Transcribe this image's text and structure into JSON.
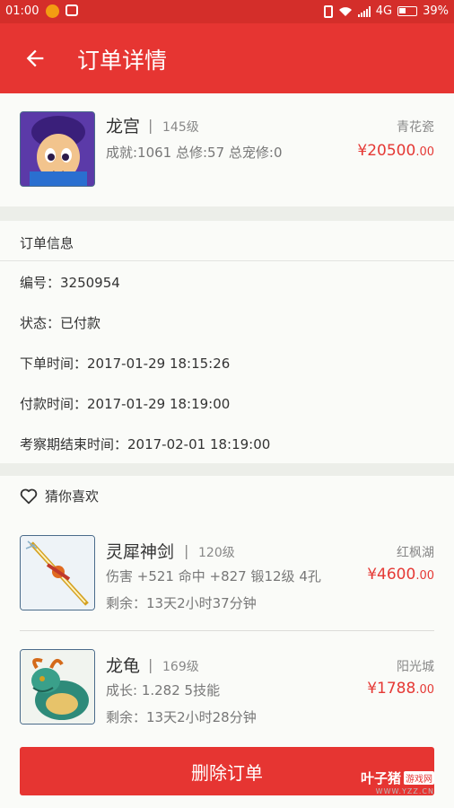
{
  "status_bar": {
    "time": "01:00",
    "network": "4G",
    "battery": "39%"
  },
  "app_bar": {
    "title": "订单详情"
  },
  "order_item": {
    "name": "龙宫",
    "separator": "|",
    "level": "145级",
    "server": "青花瓷",
    "stats": "成就:1061  总修:57  总宠修:0",
    "price_int": "¥20500",
    "price_dec": ".00",
    "thumbnail_icon": "character-portrait-icon"
  },
  "order_info": {
    "title": "订单信息",
    "number": "编号：3250954",
    "status": "状态：已付款",
    "order_time": "下单时间：2017-01-29 18:15:26",
    "pay_time": "付款时间：2017-01-29 18:19:00",
    "review_end": "考察期结束时间：2017-02-01 18:19:00"
  },
  "recommend": {
    "title": "猜你喜欢",
    "items": [
      {
        "name": "灵犀神剑",
        "separator": "|",
        "level": "120级",
        "server": "红枫湖",
        "stats": "伤害 +521  命中 +827  锻12级  4孔",
        "remaining": "剩余：13天2小时37分钟",
        "price_int": "¥4600",
        "price_dec": ".00",
        "thumbnail_icon": "sword-icon"
      },
      {
        "name": "龙龟",
        "separator": "|",
        "level": "169级",
        "server": "阳光城",
        "stats": "成长: 1.282  5技能",
        "remaining": "剩余：13天2小时28分钟",
        "price_int": "¥1788",
        "price_dec": ".00",
        "thumbnail_icon": "dragon-icon"
      }
    ]
  },
  "actions": {
    "delete_label": "删除订单"
  },
  "watermark": {
    "brand": "叶子猪",
    "tag": "游戏网",
    "url": "WWW.YZZ.CN"
  },
  "colors": {
    "primary": "#e63532",
    "status_bar": "#d42e2a",
    "price": "#e53935"
  }
}
